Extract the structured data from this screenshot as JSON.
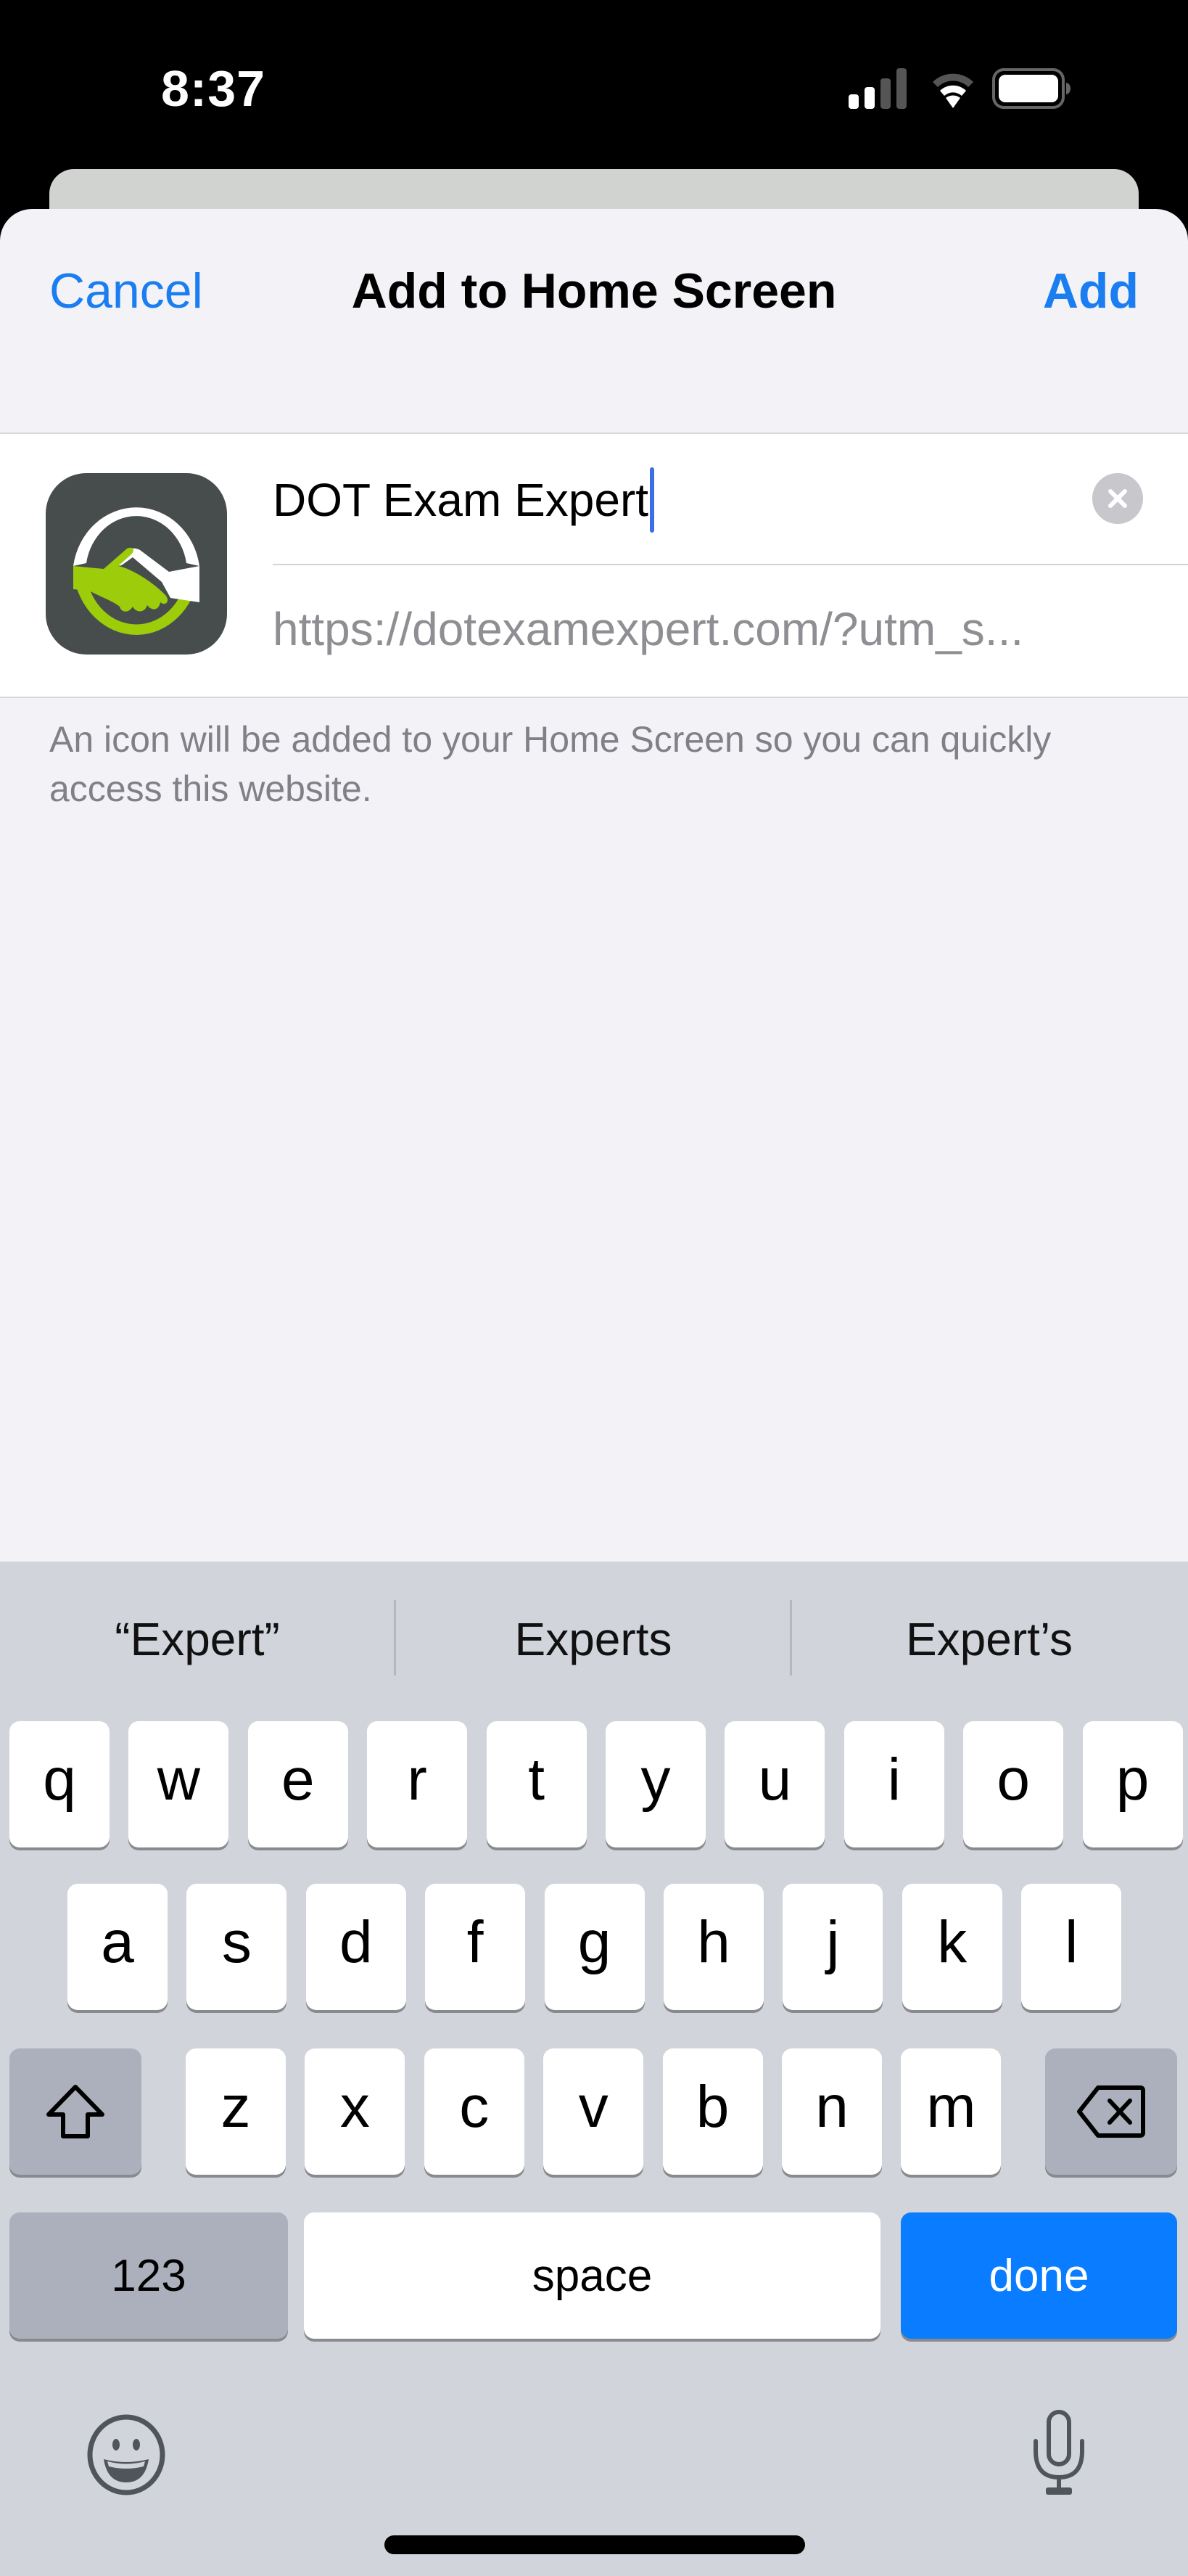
{
  "status_bar": {
    "time": "8:37",
    "icons": [
      "cellular-signal-icon",
      "wifi-icon",
      "battery-icon"
    ]
  },
  "header": {
    "cancel_label": "Cancel",
    "title": "Add to Home Screen",
    "add_label": "Add"
  },
  "shortcut": {
    "icon": "handshake-app-icon",
    "name_value": "DOT Exam Expert",
    "url": "https://dotexamexpert.com/?utm_s...",
    "clear_icon": "clear-text-icon"
  },
  "footer_note": "An icon will be added to your Home Screen so you can quickly access this website.",
  "keyboard": {
    "suggestions": [
      "“Expert”",
      "Experts",
      "Expert’s"
    ],
    "row1": [
      "q",
      "w",
      "e",
      "r",
      "t",
      "y",
      "u",
      "i",
      "o",
      "p"
    ],
    "row2": [
      "a",
      "s",
      "d",
      "f",
      "g",
      "h",
      "j",
      "k",
      "l"
    ],
    "row3": [
      "z",
      "x",
      "c",
      "v",
      "b",
      "n",
      "m"
    ],
    "numbers_label": "123",
    "space_label": "space",
    "done_label": "done",
    "shift_icon": "shift-icon",
    "delete_icon": "delete-backspace-icon",
    "emoji_icon": "emoji-icon",
    "mic_icon": "microphone-icon"
  },
  "colors": {
    "accent": "#1a7df0",
    "done_key": "#0a7cff",
    "caret": "#3d6ee8",
    "icon_green": "#9ccc0a",
    "icon_dark": "#474c4d"
  }
}
